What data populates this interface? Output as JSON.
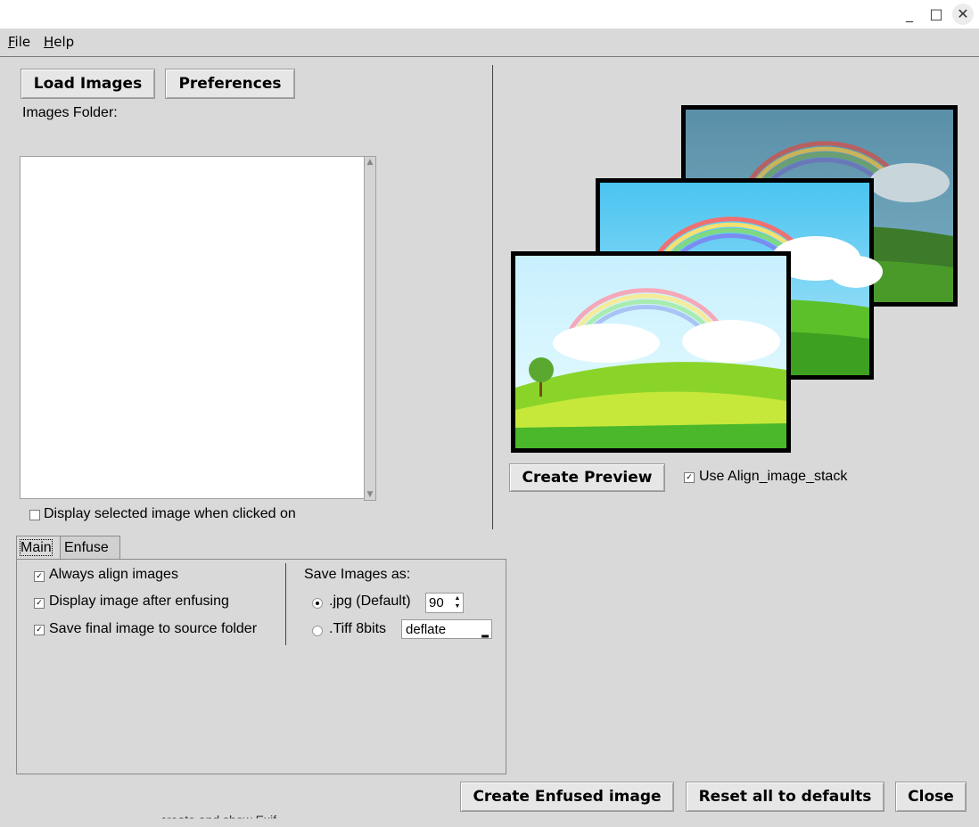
{
  "window": {
    "controls": {
      "minimize": "_",
      "maximize": "□",
      "close": "✕"
    }
  },
  "menu": {
    "file": "File",
    "help": "Help"
  },
  "toolbar": {
    "load_images": "Load Images",
    "preferences": "Preferences"
  },
  "images_folder_label": "Images Folder:",
  "display_selected_label": "Display selected image when clicked on",
  "display_selected_checked": false,
  "preview": {
    "create_preview": "Create Preview",
    "use_align_label": "Use Align_image_stack",
    "use_align_checked": true
  },
  "tabs": [
    {
      "label": "Main",
      "active": true
    },
    {
      "label": "Enfuse",
      "active": false
    }
  ],
  "main_tab": {
    "options": [
      {
        "label": "Always align images",
        "checked": true
      },
      {
        "label": "Display image after enfusing",
        "checked": true
      },
      {
        "label": "Save final image to source folder",
        "checked": true
      }
    ],
    "save_as_label": "Save Images as:",
    "jpg_label": ".jpg (Default)",
    "jpg_quality": "90",
    "tiff_label": ".Tiff 8bits",
    "tiff_compression": "deflate",
    "selected_format": "jpg"
  },
  "footer": {
    "create_enfused": "Create Enfused image",
    "reset_defaults": "Reset all to defaults",
    "close": "Close",
    "ghost_text": "create and show Exif"
  },
  "colors": {
    "window_bg": "#d9d9d9",
    "sky": "#8fd8f5",
    "grass": "#5fbf2a",
    "frame": "#000000"
  }
}
